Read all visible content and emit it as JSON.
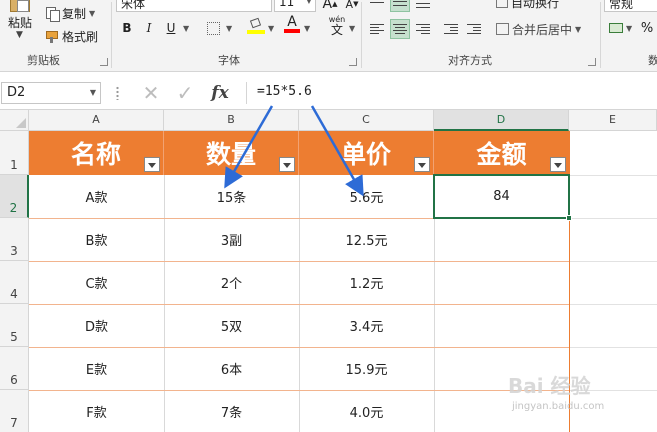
{
  "ribbon": {
    "clipboard": {
      "paste_label": "粘贴",
      "copy_label": "复制",
      "format_painter_label": "格式刷",
      "group_label": "剪贴板"
    },
    "font": {
      "font_name": "宋体",
      "font_size": "11",
      "bold": "B",
      "italic": "I",
      "underline": "U",
      "font_color_glyph": "A",
      "wen_glyph": "wén",
      "wen_char": "文",
      "group_label": "字体",
      "fill_color": "#ffff00",
      "font_color": "#ff0000"
    },
    "alignment": {
      "wrap_label": "自动换行",
      "merge_label": "合并后居中",
      "group_label": "对齐方式"
    },
    "number": {
      "format_value": "常规",
      "group_label": "数"
    }
  },
  "formula_bar": {
    "name_box": "D2",
    "fx_glyph": "fx",
    "formula": "=15*5.6"
  },
  "sheet": {
    "columns": [
      "A",
      "B",
      "C",
      "D",
      "E"
    ],
    "selected_column": "D",
    "rows": [
      "1",
      "2",
      "3",
      "4",
      "5",
      "6",
      "7"
    ],
    "selected_row": "2",
    "headers": [
      "名称",
      "数量",
      "单价",
      "金额"
    ],
    "data": [
      [
        "A款",
        "15条",
        "5.6元",
        "84"
      ],
      [
        "B款",
        "3副",
        "12.5元",
        ""
      ],
      [
        "C款",
        "2个",
        "1.2元",
        ""
      ],
      [
        "D款",
        "5双",
        "3.4元",
        ""
      ],
      [
        "E款",
        "6本",
        "15.9元",
        ""
      ],
      [
        "F款",
        "7条",
        "4.0元",
        ""
      ]
    ],
    "header_color": "#ed7d31",
    "selection_color": "#217346"
  },
  "watermark": {
    "text": "Bai 经验",
    "sub": "jingyan.baidu.com"
  }
}
